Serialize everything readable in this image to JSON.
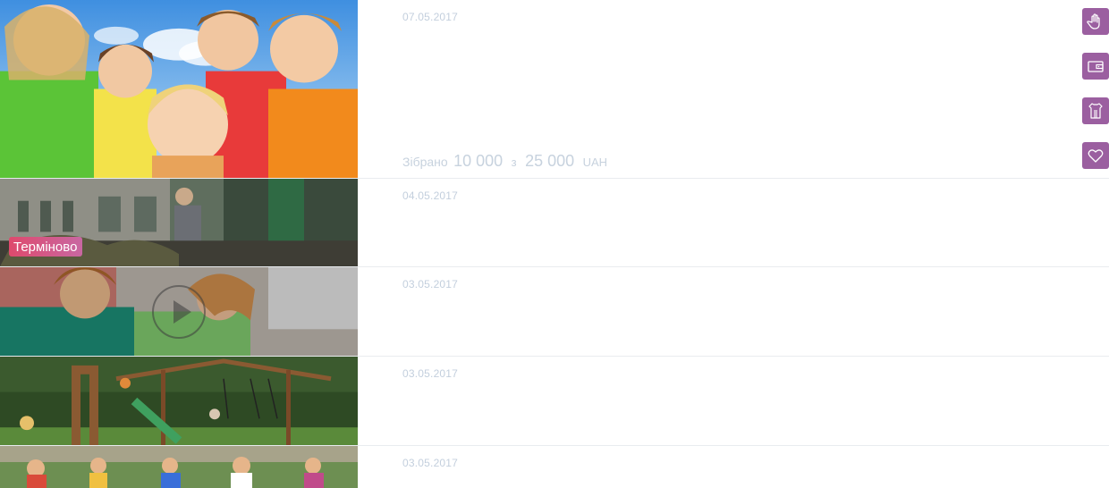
{
  "feed": {
    "items": [
      {
        "date": "07.05.2017",
        "collected": {
          "label": "Зібрано",
          "amount": "10 000",
          "of": "з",
          "goal": "25 000",
          "currency": "UAH"
        }
      },
      {
        "date": "04.05.2017",
        "badge": "Терміново"
      },
      {
        "date": "03.05.2017",
        "has_video": true
      },
      {
        "date": "03.05.2017"
      },
      {
        "date": "03.05.2017"
      }
    ]
  },
  "actions": [
    {
      "icon": "hand-icon"
    },
    {
      "icon": "wallet-icon"
    },
    {
      "icon": "clothes-icon"
    },
    {
      "icon": "heart-icon"
    }
  ],
  "colors": {
    "accent": "#9b5fa0",
    "urgent_badge": "#d9527a",
    "date_text": "#c3cfdd"
  }
}
